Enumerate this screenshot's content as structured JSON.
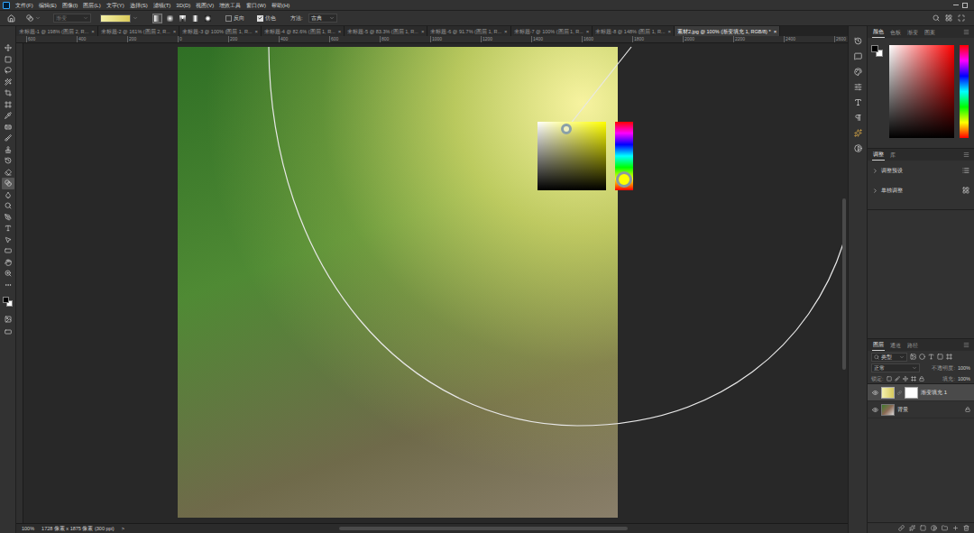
{
  "menu": [
    "文件(F)",
    "编辑(E)",
    "图像(I)",
    "图层(L)",
    "文字(Y)",
    "选择(S)",
    "滤镜(T)",
    "3D(D)",
    "视图(V)",
    "增效工具",
    "窗口(W)",
    "帮助(H)"
  ],
  "options_bar": {
    "preset": "渐变",
    "gradient_types": [
      {
        "selected": true
      },
      {
        "selected": false
      },
      {
        "selected": false
      },
      {
        "selected": false
      },
      {
        "selected": false
      }
    ],
    "checkboxes": [
      {
        "label": "反向",
        "checked": false
      },
      {
        "label": "仿色",
        "checked": true
      }
    ],
    "method_label": "方法:",
    "method": "古典"
  },
  "tools": [
    {
      "selected": false
    },
    {
      "selected": false
    },
    {
      "selected": false
    },
    {
      "selected": false
    },
    {
      "selected": false
    },
    {
      "selected": false
    },
    {
      "selected": false
    },
    {
      "selected": false
    },
    {
      "selected": false
    },
    {
      "selected": false
    },
    {
      "selected": false
    },
    {
      "selected": false
    },
    {
      "selected": true
    },
    {
      "selected": false
    },
    {
      "selected": false
    },
    {
      "selected": false
    },
    {
      "selected": false
    },
    {
      "selected": false
    },
    {
      "selected": false
    },
    {
      "selected": false
    },
    {
      "selected": false
    },
    {
      "selected": false
    }
  ],
  "tabs": [
    {
      "label": "未标题-1 @ 198% (图层 2, R...",
      "close": "×",
      "selected": false
    },
    {
      "label": "未标题-2 @ 161% (图层 2, R...",
      "close": "×",
      "selected": false
    },
    {
      "label": "未标题-3 @ 100% (图层 1, R...",
      "close": "×",
      "selected": false
    },
    {
      "label": "未标题-4 @ 82.6% (图层 1, R...",
      "close": "×",
      "selected": false
    },
    {
      "label": "未标题-5 @ 83.3% (图层 1, R...",
      "close": "×",
      "selected": false
    },
    {
      "label": "未标题-6 @ 91.7% (图层 1, R...",
      "close": "×",
      "selected": false
    },
    {
      "label": "未标题-7 @ 100% (图层 1, R...",
      "close": "×",
      "selected": false
    },
    {
      "label": "未标题-8 @ 148% (图层 1, R...",
      "close": "×",
      "selected": false
    },
    {
      "label": "素材2.jpg @ 100% (渐变填充 1, RGB/8) *",
      "close": "×",
      "selected": true
    }
  ],
  "ruler": {
    "top": [
      "600",
      "400",
      "200",
      "0",
      "200",
      "400",
      "600",
      "800",
      "1000",
      "1200",
      "1400",
      "1600",
      "1800",
      "2000",
      "2200",
      "2400",
      "2600"
    ]
  },
  "canvas": {
    "picker": {
      "saturation": 0.42,
      "brightness": 0.9,
      "hue_level": 0.84
    }
  },
  "color_panel": {
    "tabs": [
      {
        "label": "颜色",
        "selected": true
      },
      {
        "label": "色板",
        "selected": false
      },
      {
        "label": "渐变",
        "selected": false
      },
      {
        "label": "图案",
        "selected": false
      }
    ]
  },
  "adjustments_panel": {
    "tabs": [
      {
        "label": "调整",
        "selected": true
      },
      {
        "label": "库",
        "selected": false
      }
    ],
    "sections": [
      {
        "label": "调整预设",
        "expanded": false
      },
      {
        "label": "单独调整",
        "expanded": false
      }
    ]
  },
  "layers_panel": {
    "tabs": [
      {
        "label": "图层",
        "selected": true
      },
      {
        "label": "通道",
        "selected": false
      },
      {
        "label": "路径",
        "selected": false
      }
    ],
    "filter": "类型",
    "blend_mode": "正常",
    "opacity_label": "不透明度:",
    "opacity": "100%",
    "lock_label": "锁定:",
    "fill_label": "填充:",
    "fill": "100%",
    "layers": [
      {
        "name": "渐变填充 1",
        "kind": "fill",
        "visible": true,
        "selected": true,
        "locked": false
      },
      {
        "name": "背景",
        "kind": "background",
        "visible": true,
        "selected": false,
        "locked": true
      }
    ]
  },
  "status_bar": {
    "zoom": "100%",
    "info": "1728 像素 x 1875 像素 (300 ppi)",
    "arrow": ">"
  }
}
